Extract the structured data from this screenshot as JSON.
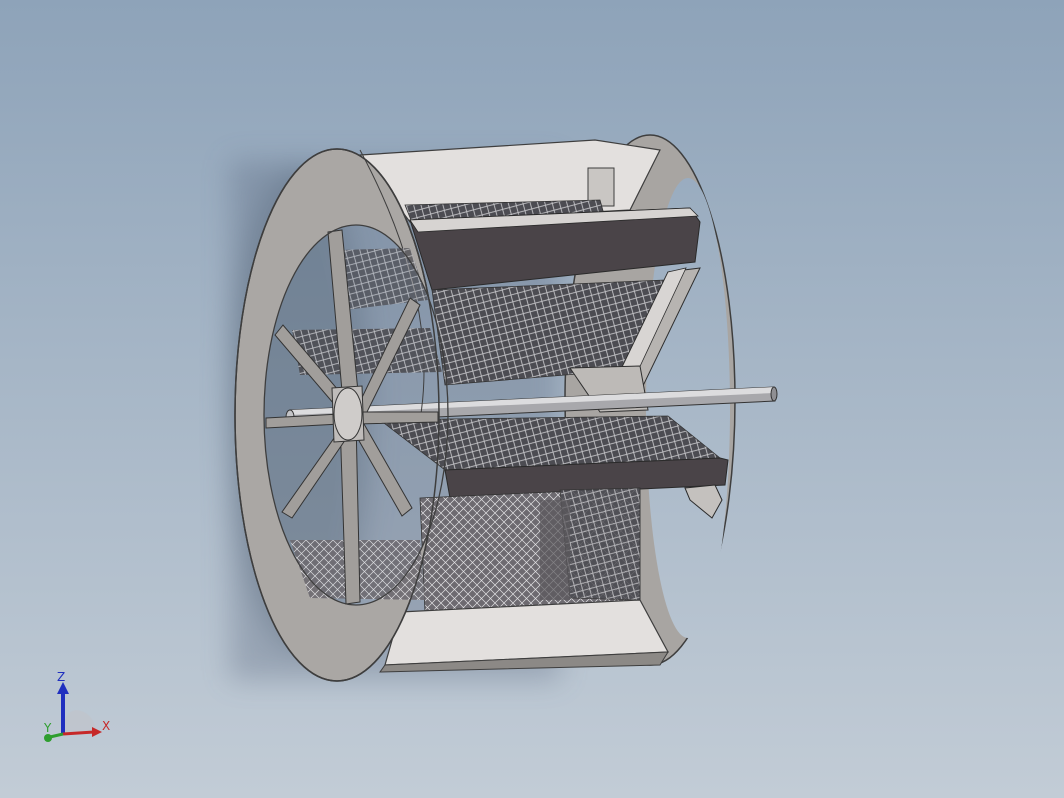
{
  "viewport": {
    "background_top": "#8ea3b9",
    "background_bottom": "#c2ccd6"
  },
  "model": {
    "body_color": "#a9a6a3",
    "body_shadow": "#8e8b88",
    "dark_panel": "#4a4448",
    "light_panel": "#dedbd9",
    "mesh_color": "#3a3a40",
    "shaft_color": "#9a9a9e"
  },
  "triad": {
    "labels": {
      "z": "Z",
      "x": "X",
      "y": "Y"
    },
    "colors": {
      "z": "#1f2fbf",
      "x": "#c62828",
      "y": "#2e9e2e"
    }
  }
}
